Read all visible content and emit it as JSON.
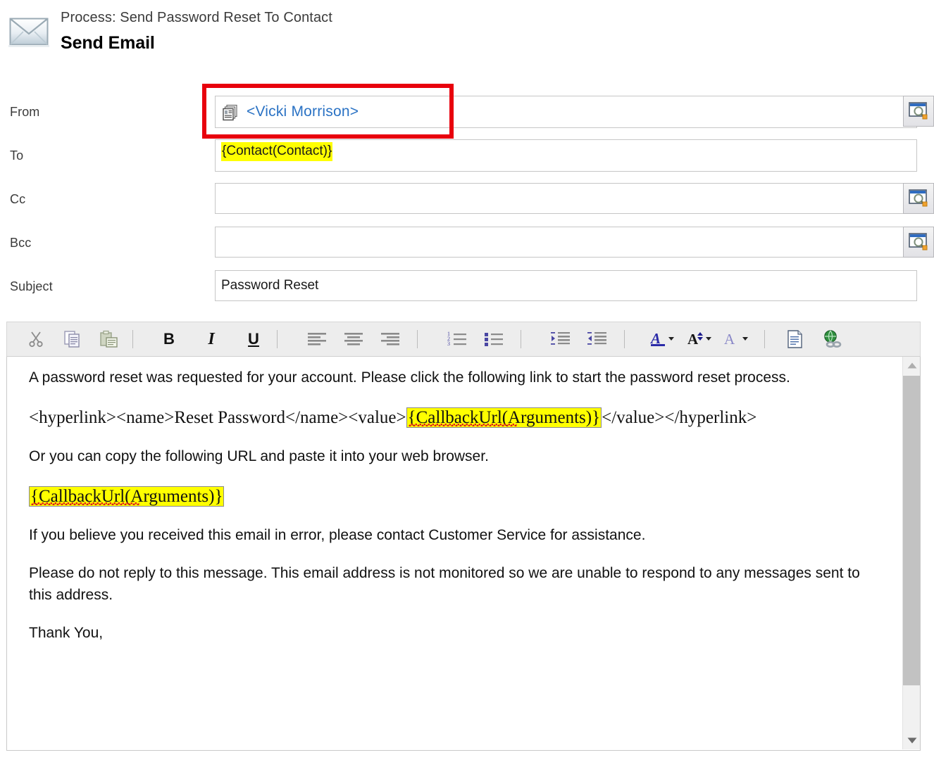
{
  "header": {
    "envelope_icon": "envelope-icon",
    "process_label": "Process: Send Password Reset To Contact",
    "title": "Send Email"
  },
  "fields": {
    "from": {
      "label": "From",
      "icon": "record-stack-icon",
      "value": "<Vicki Morrison>",
      "value_color": "#2a72c4",
      "has_lookup": true,
      "lookup_icon": "lookup-magnifier-icon",
      "highlight_box_color": "#e8000d"
    },
    "to": {
      "label": "To",
      "value": "{Contact(Contact)}",
      "highlight_color": "#ffff00",
      "has_lookup": false
    },
    "cc": {
      "label": "Cc",
      "value": "",
      "has_lookup": true,
      "lookup_icon": "lookup-magnifier-icon"
    },
    "bcc": {
      "label": "Bcc",
      "value": "",
      "has_lookup": true,
      "lookup_icon": "lookup-magnifier-icon"
    },
    "subject": {
      "label": "Subject",
      "value": "Password Reset",
      "has_lookup": false
    }
  },
  "toolbar": {
    "buttons": [
      {
        "name": "cut-icon",
        "label": "Cut"
      },
      {
        "name": "copy-icon",
        "label": "Copy"
      },
      {
        "name": "paste-icon",
        "label": "Paste"
      },
      {
        "name": "bold-icon",
        "label": "B"
      },
      {
        "name": "italic-icon",
        "label": "I"
      },
      {
        "name": "underline-icon",
        "label": "U"
      },
      {
        "name": "align-left-icon",
        "label": "Align Left"
      },
      {
        "name": "align-center-icon",
        "label": "Align Center"
      },
      {
        "name": "align-right-icon",
        "label": "Align Right"
      },
      {
        "name": "numbered-list-icon",
        "label": "Numbered List"
      },
      {
        "name": "bulleted-list-icon",
        "label": "Bulleted List"
      },
      {
        "name": "increase-indent-icon",
        "label": "Increase Indent"
      },
      {
        "name": "decrease-indent-icon",
        "label": "Decrease Indent"
      },
      {
        "name": "font-color-icon",
        "label": "Font Color"
      },
      {
        "name": "font-size-icon",
        "label": "Font Size"
      },
      {
        "name": "background-color-icon",
        "label": "Background Color"
      },
      {
        "name": "page-source-icon",
        "label": "Source"
      },
      {
        "name": "insert-hyperlink-icon",
        "label": "Insert Hyperlink"
      }
    ]
  },
  "body": {
    "p1": "A password reset was requested for your account. Please click the following link to start the password reset process.",
    "p2_pre": "<hyperlink><name>Reset Password</name><value>",
    "p2_token": "{CallbackUrl(Arguments)}",
    "p2_post": "</value></hyperlink>",
    "p3": "Or you can copy the following URL and paste it into your web browser.",
    "p4_token": "{CallbackUrl(Arguments)}",
    "p5": "If you believe you received this email in error, please contact Customer Service for assistance.",
    "p6": "Please do not reply to this message. This email address is not monitored so we are unable to respond to any messages sent to this address.",
    "p7": "Thank You,"
  },
  "scrollbar": {
    "up_icon": "scroll-up-arrow-icon",
    "down_icon": "scroll-down-arrow-icon",
    "thumb": "scroll-thumb"
  }
}
